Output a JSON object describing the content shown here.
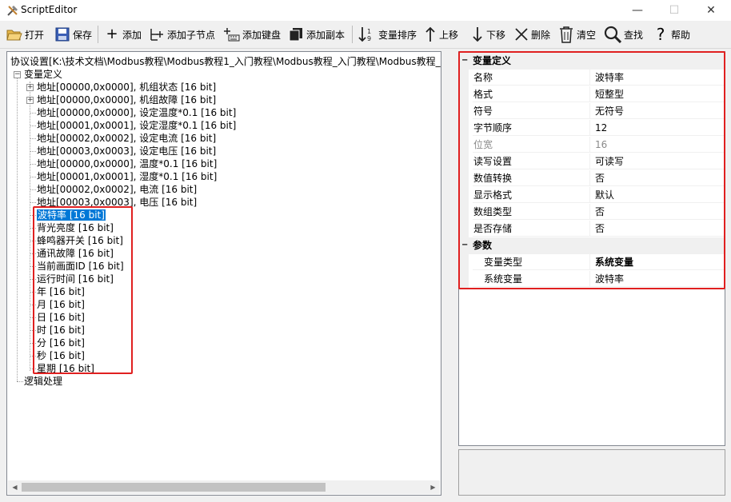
{
  "window": {
    "title": "ScriptEditor",
    "minimize": "—",
    "maximize": "☐",
    "close": "✕"
  },
  "toolbar": {
    "open": "打开",
    "save": "保存",
    "add": "添加",
    "add_child": "添加子节点",
    "add_key": "添加键盘",
    "add_copy": "添加副本",
    "sort": "变量排序",
    "move_up": "上移",
    "move_down": "下移",
    "delete": "删除",
    "clear": "清空",
    "find": "查找",
    "help": "帮助"
  },
  "tree": {
    "root": "协议设置[K:\\技术文档\\Modbus教程\\Modbus教程1_入门教程\\Modbus教程_入门教程\\Modbus教程_入",
    "var_def": "变量定义",
    "addr_items": [
      "地址[00000,0x0000], 机组状态 [16 bit]",
      "地址[00000,0x0000], 机组故障 [16 bit]",
      "地址[00000,0x0000], 设定温度*0.1 [16 bit]",
      "地址[00001,0x0001], 设定湿度*0.1 [16 bit]",
      "地址[00002,0x0002], 设定电流 [16 bit]",
      "地址[00003,0x0003], 设定电压 [16 bit]",
      "地址[00000,0x0000], 温度*0.1 [16 bit]",
      "地址[00001,0x0001], 湿度*0.1 [16 bit]",
      "地址[00002,0x0002], 电流 [16 bit]",
      "地址[00003,0x0003], 电压 [16 bit]"
    ],
    "sys_items": [
      "波特率 [16 bit]",
      "背光亮度 [16 bit]",
      "蜂鸣器开关 [16 bit]",
      "通讯故障 [16 bit]",
      "当前画面ID [16 bit]",
      "运行时间 [16 bit]",
      "年 [16 bit]",
      "月 [16 bit]",
      "日 [16 bit]",
      "时 [16 bit]",
      "分 [16 bit]",
      "秒 [16 bit]",
      "星期 [16 bit]"
    ],
    "logic": "逻辑处理"
  },
  "props": {
    "cat_var": "变量定义",
    "rows": [
      {
        "name": "名称",
        "value": "波特率"
      },
      {
        "name": "格式",
        "value": "短整型"
      },
      {
        "name": "符号",
        "value": "无符号"
      },
      {
        "name": "字节顺序",
        "value": "12"
      },
      {
        "name": "位宽",
        "value": "16"
      },
      {
        "name": "读写设置",
        "value": "可读写"
      },
      {
        "name": "数值转换",
        "value": "否"
      },
      {
        "name": "显示格式",
        "value": "默认"
      },
      {
        "name": "数组类型",
        "value": "否"
      },
      {
        "name": "是否存储",
        "value": "否"
      }
    ],
    "cat_param": "参数",
    "param_rows": [
      {
        "name": "变量类型",
        "value": "系统变量"
      },
      {
        "name": "系统变量",
        "value": "波特率"
      }
    ]
  },
  "colors": {
    "highlight": "#e02020",
    "selection": "#0078d7"
  }
}
